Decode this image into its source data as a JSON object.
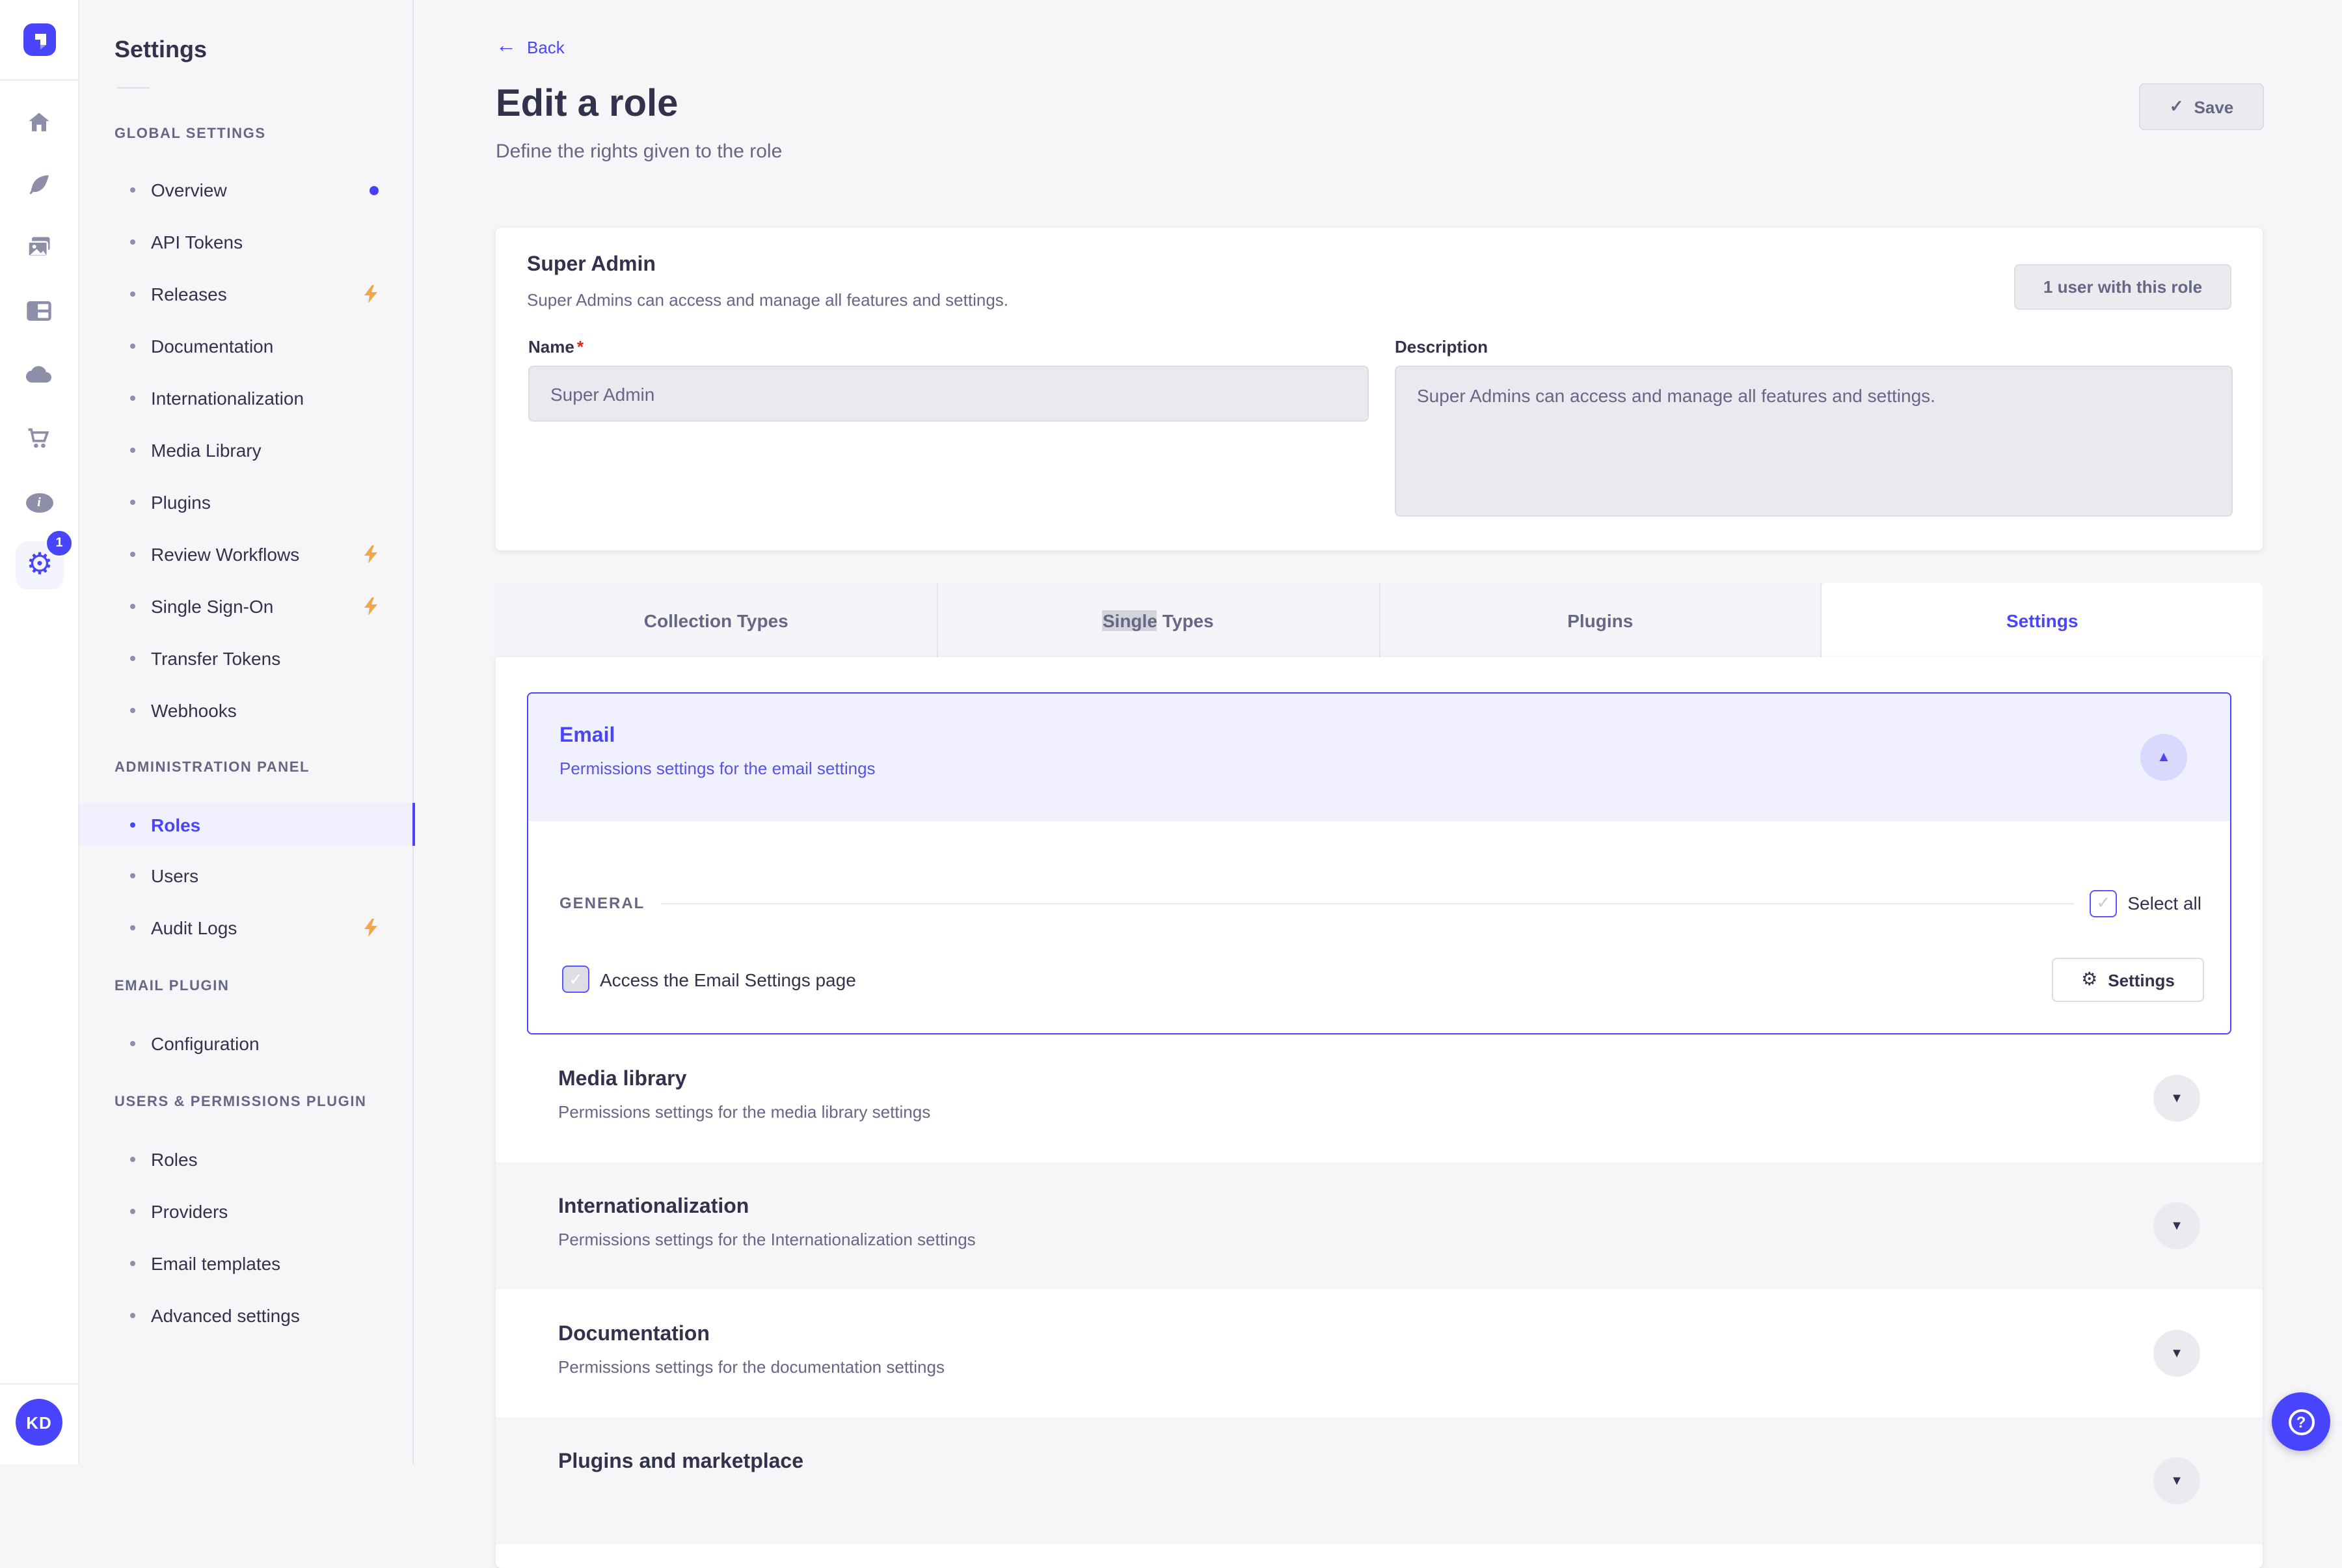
{
  "colors": {
    "accent": "#4945ff",
    "accent_light_bg": "#f0f0ff",
    "page_bg": "#f6f6f9",
    "text_dark": "#32324d",
    "text_gray": "#666687",
    "border": "#dcdce4",
    "lightning": "#f0a64c",
    "required_red": "#d02b20"
  },
  "iconbar": {
    "icons": [
      "strapi-logo",
      "home",
      "content-manager",
      "media-library",
      "content-type-builder",
      "cloud",
      "marketplace",
      "info",
      "settings"
    ],
    "settings_badge": "1",
    "avatar_initials": "KD"
  },
  "sidebar": {
    "title": "Settings",
    "sections": [
      {
        "label": "GLOBAL SETTINGS",
        "items": [
          {
            "label": "Overview"
          },
          {
            "label": "API Tokens"
          },
          {
            "label": "Releases"
          },
          {
            "label": "Documentation"
          },
          {
            "label": "Internationalization"
          },
          {
            "label": "Media Library"
          },
          {
            "label": "Plugins"
          },
          {
            "label": "Review Workflows"
          },
          {
            "label": "Single Sign-On"
          },
          {
            "label": "Transfer Tokens"
          },
          {
            "label": "Webhooks"
          }
        ]
      },
      {
        "label": "ADMINISTRATION PANEL",
        "items": [
          {
            "label": "Roles"
          },
          {
            "label": "Users"
          },
          {
            "label": "Audit Logs"
          }
        ]
      },
      {
        "label": "EMAIL PLUGIN",
        "items": [
          {
            "label": "Configuration"
          }
        ]
      },
      {
        "label": "USERS & PERMISSIONS PLUGIN",
        "items": [
          {
            "label": "Roles"
          },
          {
            "label": "Providers"
          },
          {
            "label": "Email templates"
          },
          {
            "label": "Advanced settings"
          }
        ]
      }
    ]
  },
  "header": {
    "back_label": "Back",
    "title": "Edit a role",
    "subtitle": "Define the rights given to the role",
    "save_label": "Save",
    "save_check": "✓"
  },
  "role_card": {
    "title": "Super Admin",
    "subtitle": "Super Admins can access and manage all features and settings.",
    "users_button": "1 user with this role",
    "name_label": "Name",
    "name_required": "*",
    "name_value": "Super Admin",
    "description_label": "Description",
    "description_value": "Super Admins can access and manage all features and settings."
  },
  "tabs": {
    "collection_types": "Collection Types",
    "single_types_highlight": "Single",
    "single_types_rest": "Types",
    "plugins": "Plugins",
    "settings": "Settings"
  },
  "permissions": {
    "email": {
      "title": "Email",
      "subtitle": "Permissions settings for the email settings",
      "collapse_glyph": "▲",
      "section_label": "GENERAL",
      "select_all_label": "Select all",
      "select_all_check": "✓",
      "access_label": "Access the Email Settings page",
      "access_check": "✓",
      "settings_button": "Settings"
    },
    "rows": [
      {
        "title": "Media library",
        "subtitle": "Permissions settings for the media library settings",
        "glyph": "▼"
      },
      {
        "title": "Internationalization",
        "subtitle": "Permissions settings for the Internationalization settings",
        "glyph": "▼"
      },
      {
        "title": "Documentation",
        "subtitle": "Permissions settings for the documentation settings",
        "glyph": "▼"
      },
      {
        "title": "Plugins and marketplace",
        "subtitle": "",
        "glyph": "▼"
      }
    ]
  },
  "help": {
    "glyph": "?"
  }
}
